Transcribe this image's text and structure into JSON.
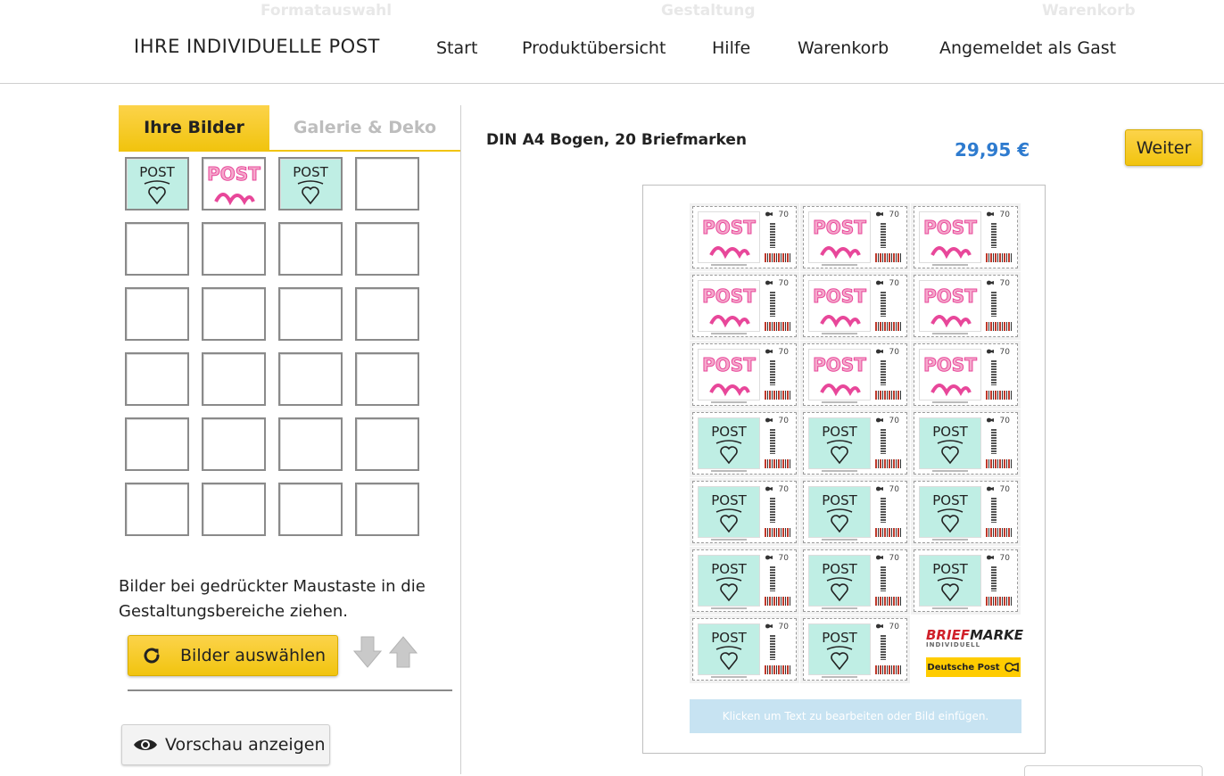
{
  "steps": [
    "Formatauswahl",
    "Gestaltung",
    "Warenkorb"
  ],
  "brand": "IHRE INDIVIDUELLE POST",
  "nav": [
    "Start",
    "Produktübersicht",
    "Hilfe",
    "Warenkorb",
    "Angemeldet als Gast"
  ],
  "tabs": {
    "active": "Ihre Bilder",
    "inactive": "Galerie & Deko"
  },
  "thumbnails": [
    {
      "slot": 1,
      "text": "POST",
      "image": "post-mit-herz"
    },
    {
      "slot": 2,
      "text": "POST",
      "image": "post-fuer-dich"
    },
    {
      "slot": 3,
      "text": "POST",
      "image": "post-mit-herz"
    }
  ],
  "empty_slots": 21,
  "hint": "Bilder bei gedrückter Maustaste in die Gestaltungsbereiche ziehen.",
  "buttons": {
    "choose": "Bilder auswählen",
    "preview": "Vorschau anzeigen",
    "next": "Weiter"
  },
  "product": {
    "title": "DIN A4 Bogen, 20 Briefmarken",
    "price": "29,95 €"
  },
  "stamp": {
    "value": "70",
    "image_text": "POST"
  },
  "sheet_rows": [
    [
      "pink",
      "pink",
      "pink"
    ],
    [
      "pink",
      "pink",
      "pink"
    ],
    [
      "pink",
      "pink",
      "pink"
    ],
    [
      "mint",
      "mint",
      "mint"
    ],
    [
      "mint",
      "mint",
      "mint"
    ],
    [
      "mint",
      "mint",
      "mint"
    ],
    [
      "mint",
      "mint"
    ]
  ],
  "logo": {
    "brief": "BRIEF",
    "marke": "MARKE",
    "individuell": "INDIVIDUELL",
    "deutsche_post": "Deutsche Post"
  },
  "text_bar": "Klicken um Text zu bearbeiten oder Bild einfügen.",
  "colors": {
    "accent_yellow": "#f1c40f",
    "price_blue": "#2e7bcf",
    "mint": "#bfeee4",
    "pink": "#e8479a"
  }
}
